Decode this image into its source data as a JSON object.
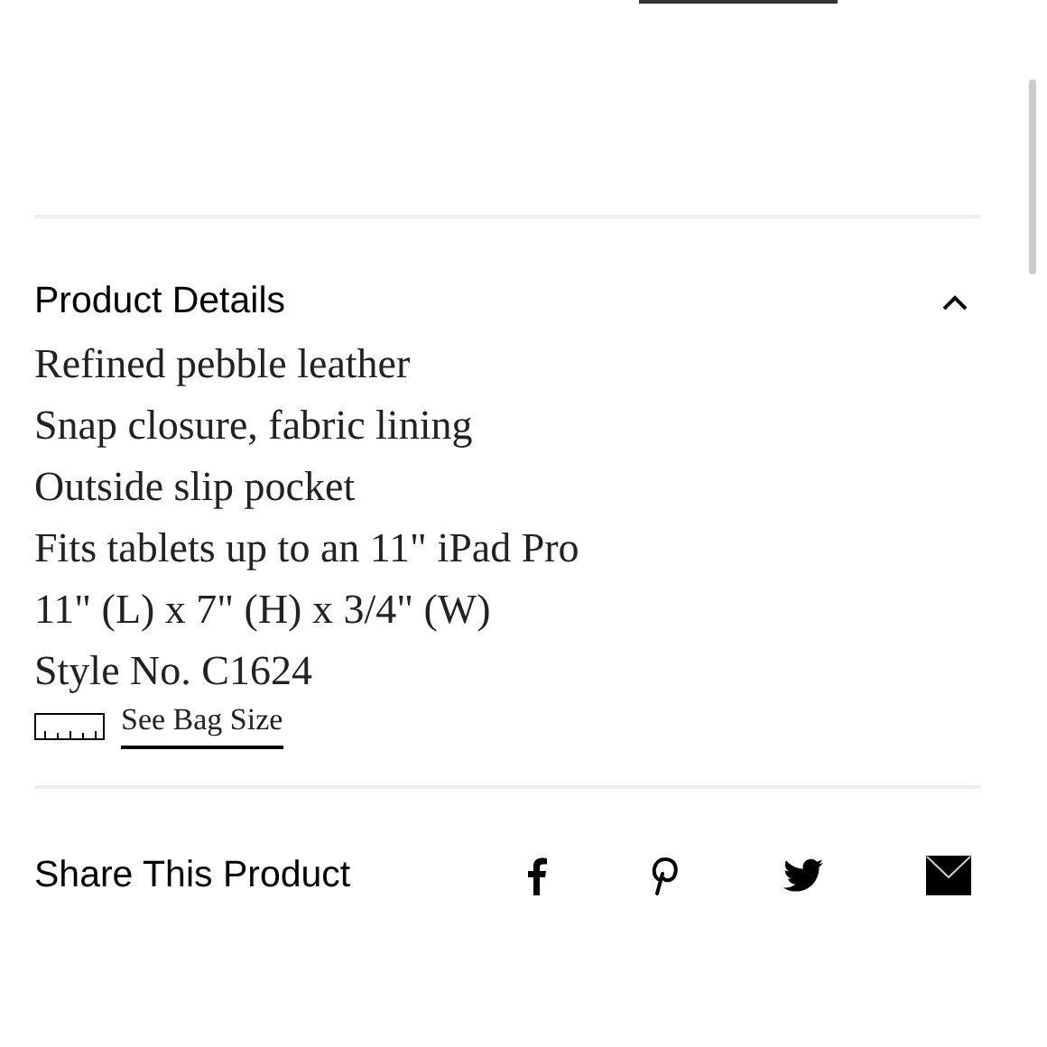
{
  "details": {
    "title": "Product Details",
    "expanded": true,
    "lines": [
      "Refined pebble leather",
      "Snap closure, fabric lining",
      "Outside slip pocket",
      "Fits tablets up to an 11\" iPad Pro",
      "11\" (L) x 7\" (H) x 3/4\" (W)",
      "Style No. C1624"
    ],
    "size_link": "See Bag Size"
  },
  "share": {
    "title": "Share This Product"
  }
}
